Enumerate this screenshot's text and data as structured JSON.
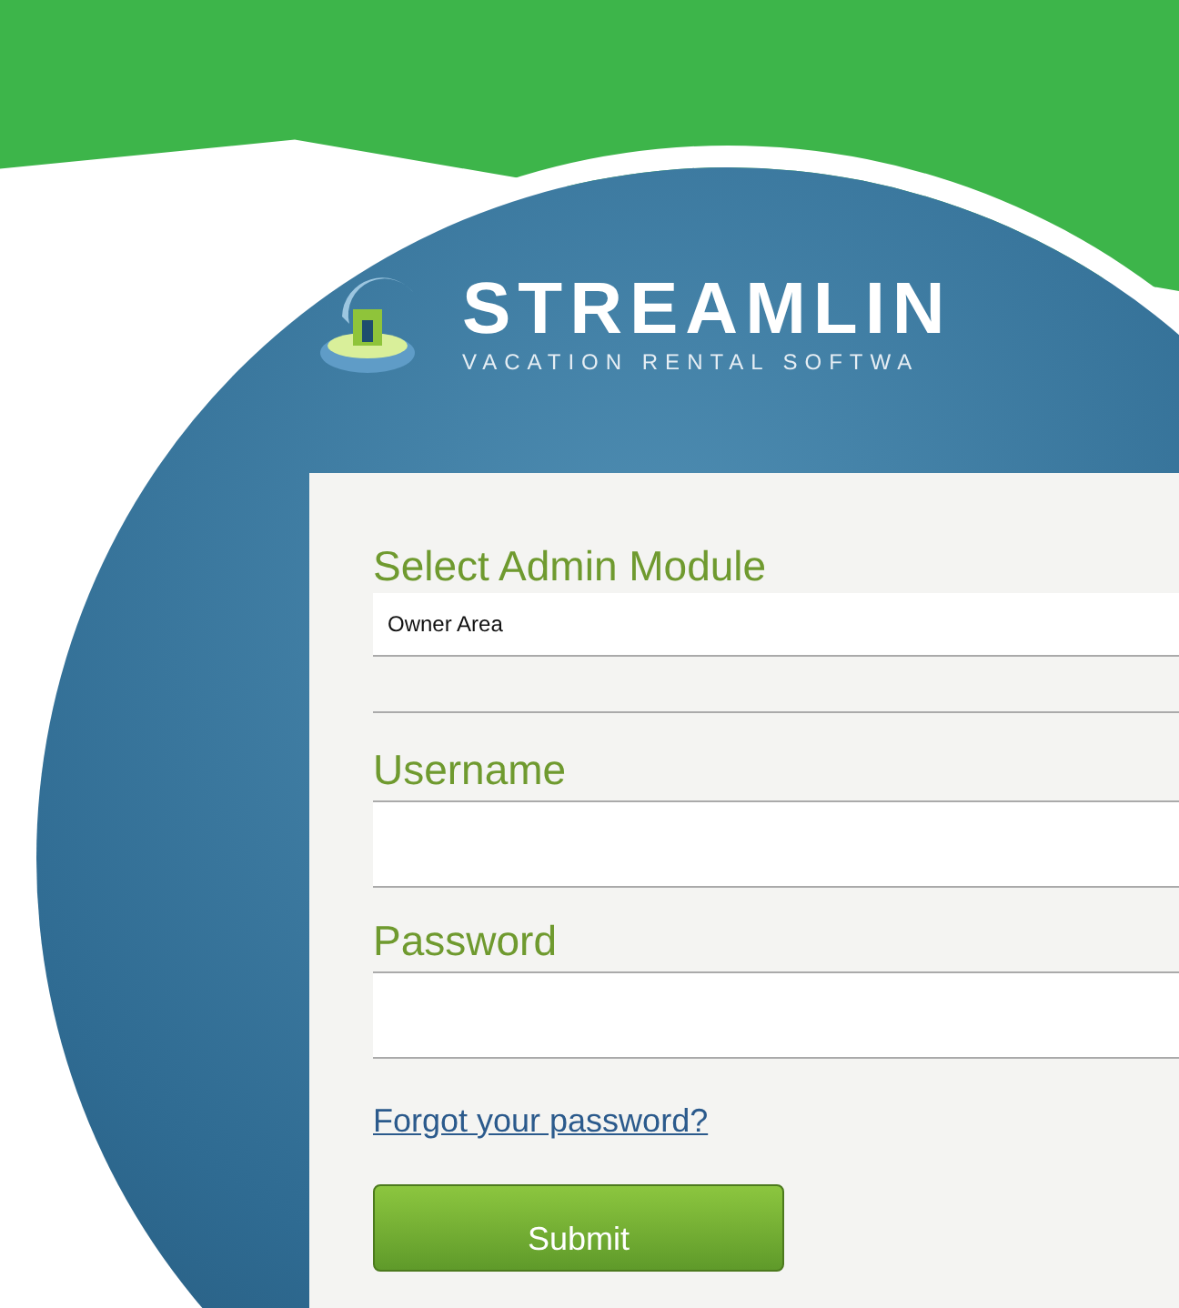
{
  "logo": {
    "title": "STREAMLIN",
    "tagline": "VACATION RENTAL SOFTWA"
  },
  "form": {
    "module_label": "Select Admin Module",
    "module_value": "Owner Area",
    "fields": [
      {
        "label": "Username"
      },
      {
        "label": "Password"
      }
    ],
    "forgot_link": "Forgot your password?",
    "submit": "Submit"
  }
}
